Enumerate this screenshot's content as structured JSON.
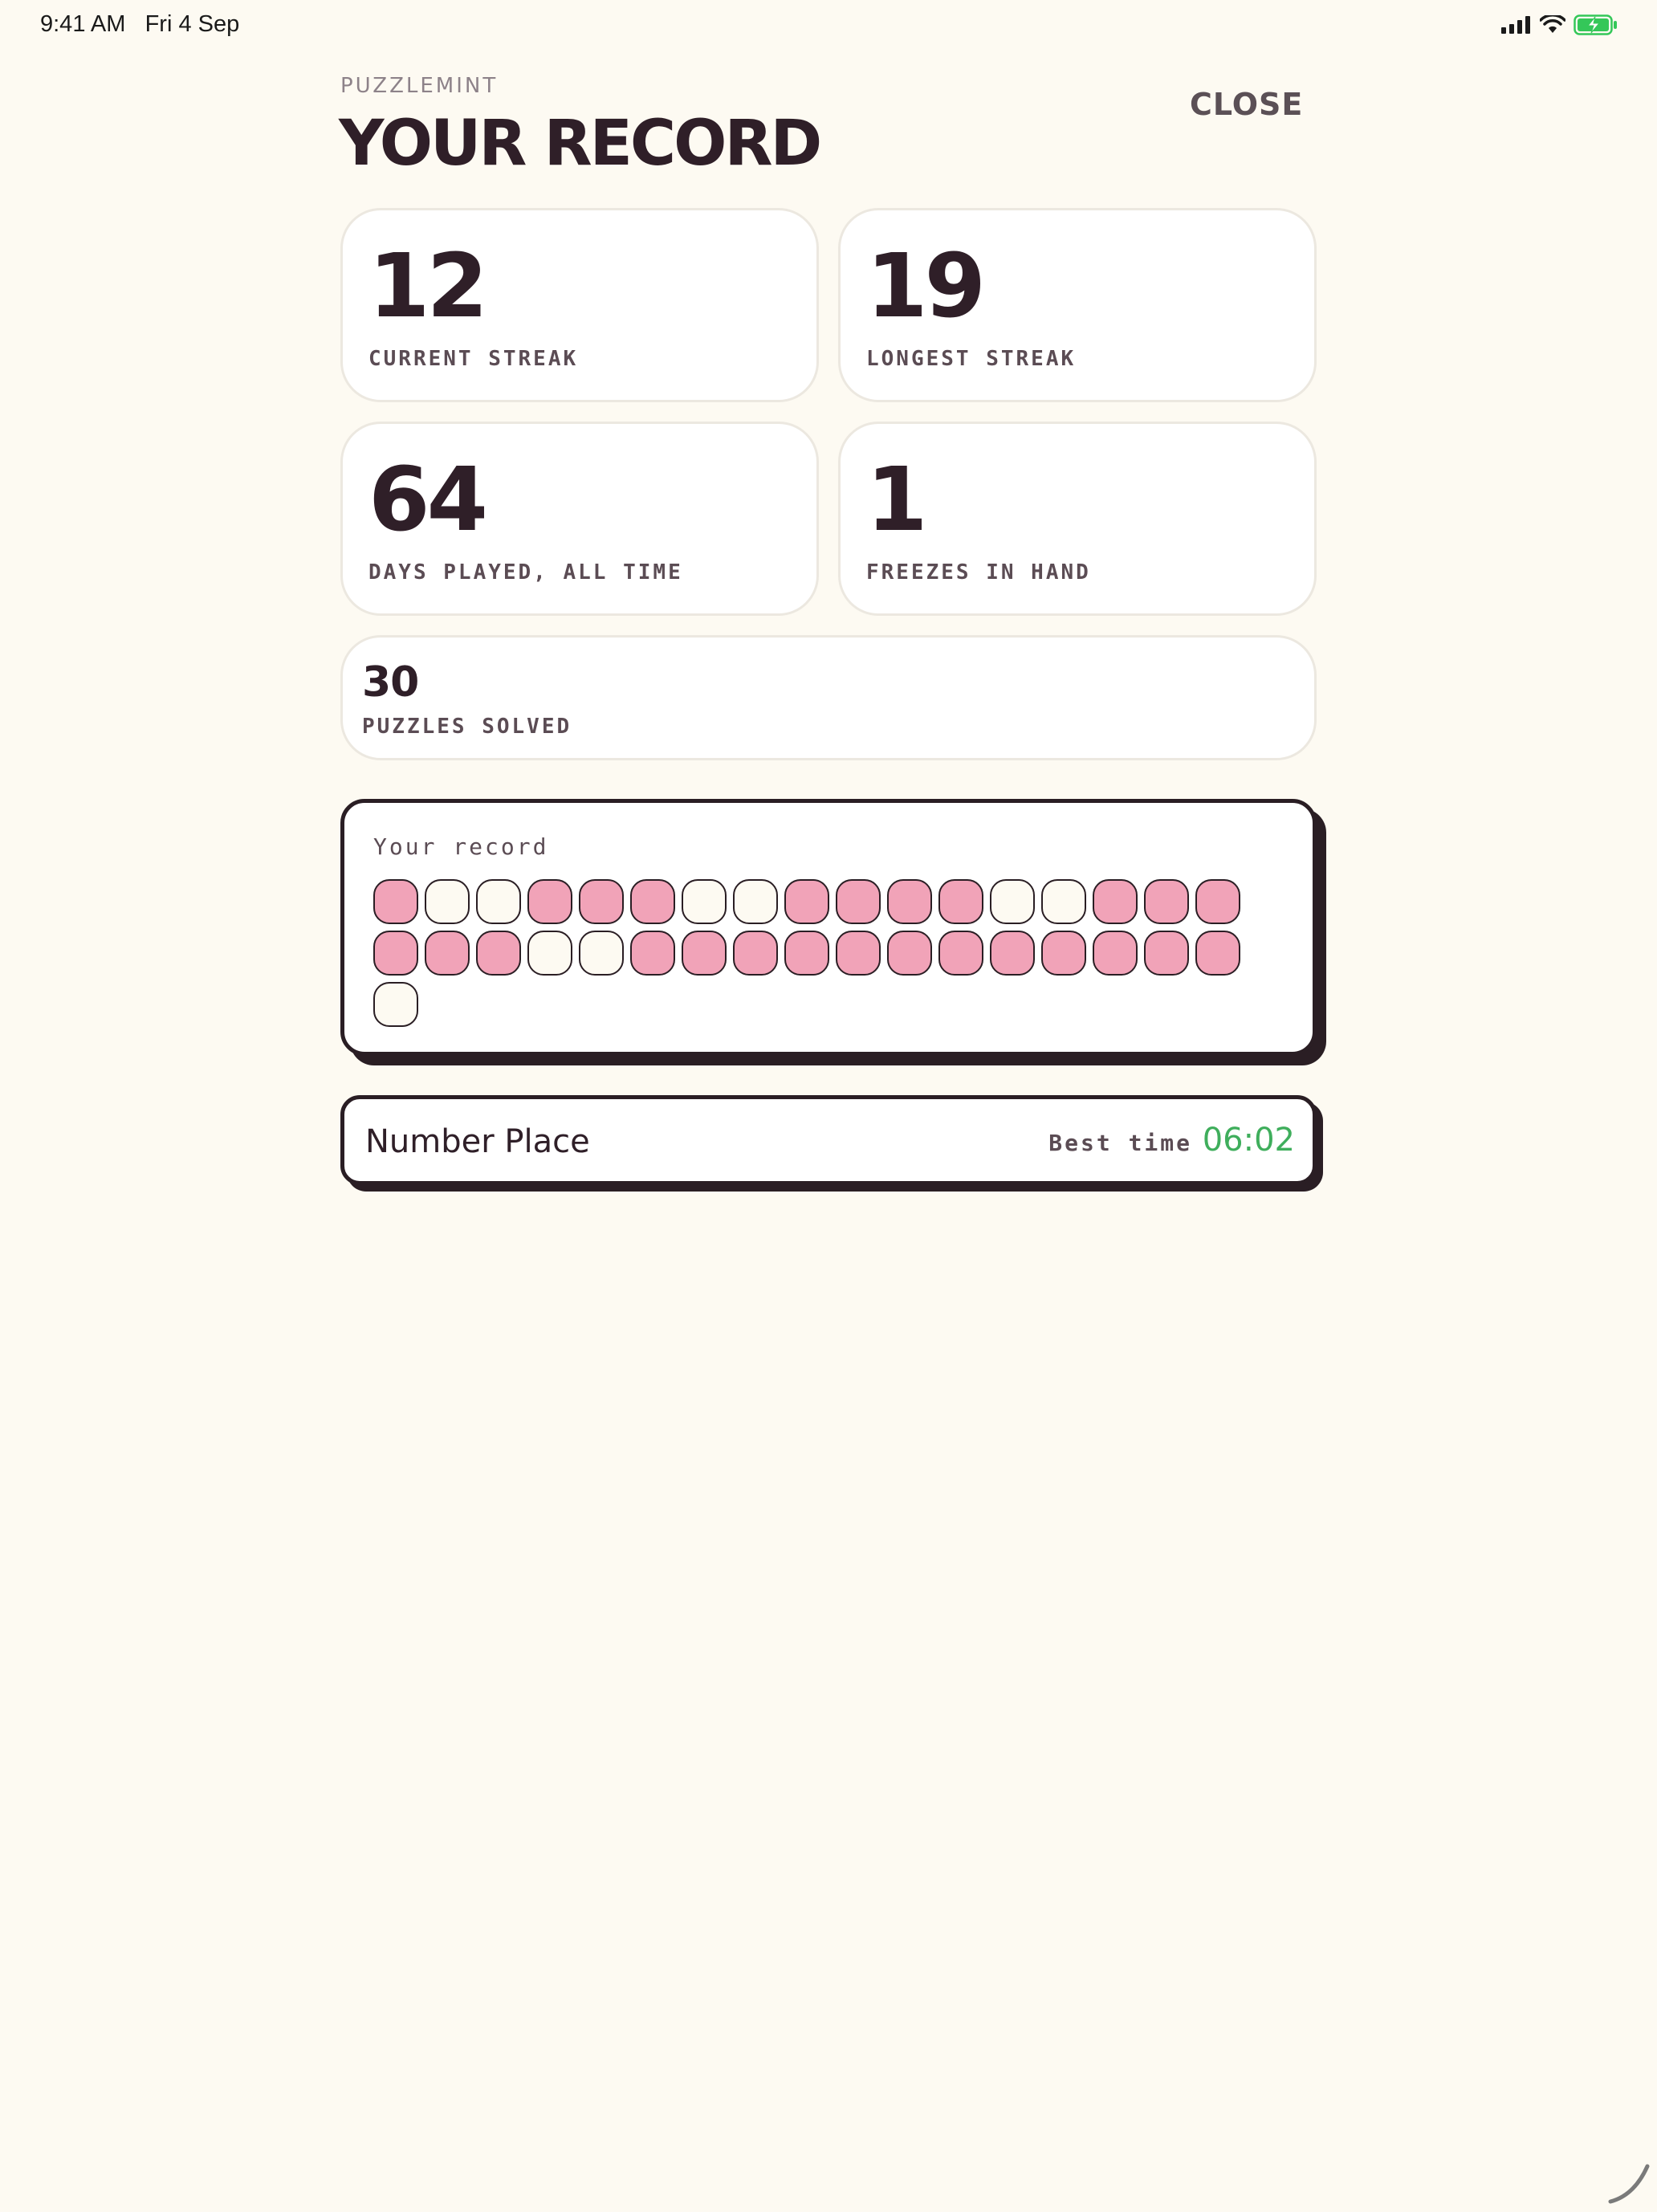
{
  "status_bar": {
    "time": "9:41 AM",
    "date": "Fri 4 Sep",
    "icons": [
      "signal-icon",
      "wifi-icon",
      "battery-charging-icon"
    ],
    "battery_color": "#34c759"
  },
  "header": {
    "eyebrow": "PUZZLEMINT",
    "title": "YOUR RECORD",
    "close_label": "CLOSE"
  },
  "stats": [
    {
      "value": "12",
      "label": "CURRENT STREAK"
    },
    {
      "value": "19",
      "label": "LONGEST STREAK"
    },
    {
      "value": "64",
      "label": "DAYS PLAYED, ALL TIME"
    },
    {
      "value": "1",
      "label": "FREEZES IN HAND"
    },
    {
      "value": "30",
      "label": "PUZZLES SOLVED"
    }
  ],
  "record": {
    "title": "Your record",
    "days": [
      1,
      0,
      0,
      1,
      1,
      1,
      0,
      0,
      1,
      1,
      1,
      1,
      0,
      0,
      1,
      1,
      1,
      1,
      1,
      1,
      0,
      0,
      1,
      1,
      1,
      1,
      1,
      1,
      1,
      1,
      1,
      1,
      1,
      1,
      0
    ],
    "filled_color": "#f1a3b8",
    "empty_color": "#fdfaf2"
  },
  "best_time": {
    "game": "Number Place",
    "label": "Best time",
    "value": "06:02",
    "value_color": "#3fae5c"
  }
}
